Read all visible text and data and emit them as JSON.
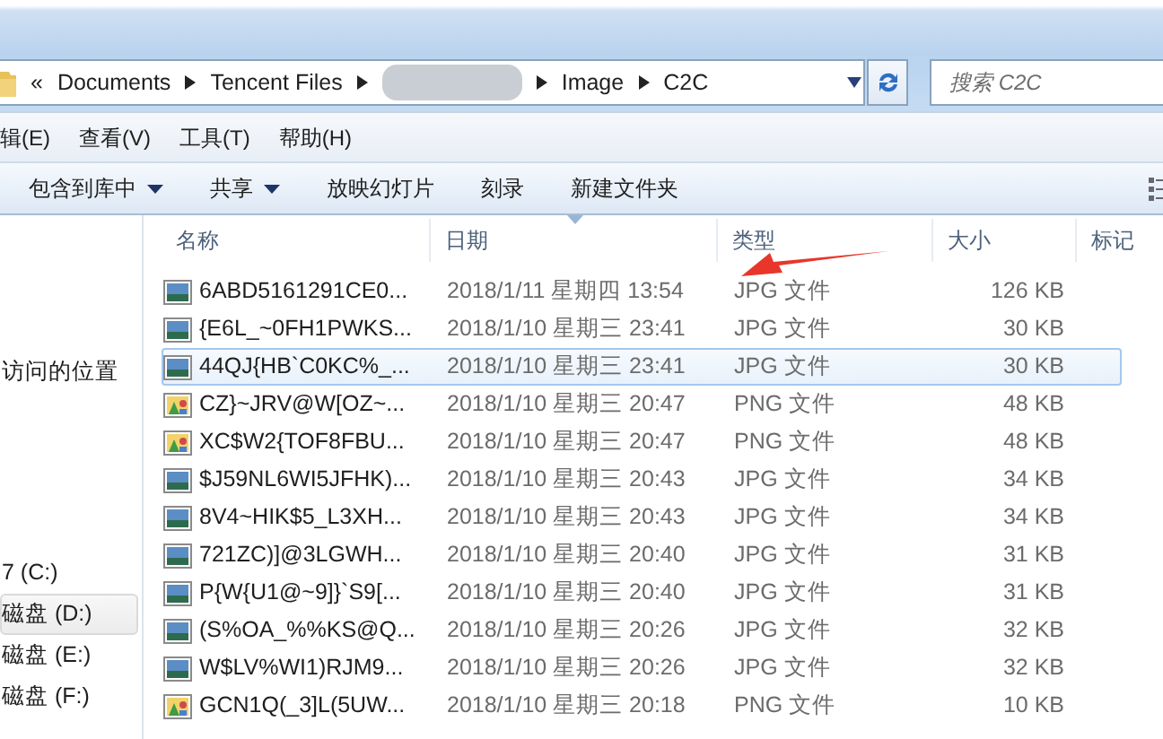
{
  "address_bar": {
    "overflow": "«",
    "crumbs": [
      {
        "kind": "text",
        "label": "Documents"
      },
      {
        "kind": "text",
        "label": "Tencent Files"
      },
      {
        "kind": "redacted"
      },
      {
        "kind": "text",
        "label": "Image"
      },
      {
        "kind": "text",
        "label": "C2C"
      }
    ]
  },
  "search": {
    "placeholder": "搜索 C2C"
  },
  "menu": [
    "辑(E)",
    "查看(V)",
    "工具(T)",
    "帮助(H)"
  ],
  "toolbar": [
    {
      "label": "包含到库中",
      "dropdown": true
    },
    {
      "label": "共享",
      "dropdown": true
    },
    {
      "label": "放映幻灯片",
      "dropdown": false
    },
    {
      "label": "刻录",
      "dropdown": false
    },
    {
      "label": "新建文件夹",
      "dropdown": false
    }
  ],
  "sidebar": [
    {
      "kind": "gap"
    },
    {
      "kind": "item",
      "label": "访问的位置",
      "selected": false
    },
    {
      "kind": "gap"
    },
    {
      "kind": "item",
      "label": "7 (C:)",
      "selected": false
    },
    {
      "kind": "item",
      "label": "磁盘 (D:)",
      "selected": true
    },
    {
      "kind": "item",
      "label": "磁盘 (E:)",
      "selected": false
    },
    {
      "kind": "item",
      "label": "磁盘 (F:)",
      "selected": false
    }
  ],
  "columns": [
    {
      "label": "名称",
      "sorted": false
    },
    {
      "label": "日期",
      "sorted": true
    },
    {
      "label": "类型",
      "sorted": false
    },
    {
      "label": "大小",
      "sorted": false
    },
    {
      "label": "标记",
      "sorted": false
    }
  ],
  "files": [
    {
      "kind": "jpg",
      "name": "6ABD5161291CE0...",
      "date": "2018/1/11 星期四 13:54",
      "type": "JPG 文件",
      "size": "126 KB",
      "selected": false
    },
    {
      "kind": "jpg",
      "name": "{E6L_~0FH1PWKS...",
      "date": "2018/1/10 星期三 23:41",
      "type": "JPG 文件",
      "size": "30 KB",
      "selected": false
    },
    {
      "kind": "jpg",
      "name": "44QJ{HB`C0KC%_...",
      "date": "2018/1/10 星期三 23:41",
      "type": "JPG 文件",
      "size": "30 KB",
      "selected": true
    },
    {
      "kind": "png",
      "name": "CZ}~JRV@W[OZ~...",
      "date": "2018/1/10 星期三 20:47",
      "type": "PNG 文件",
      "size": "48 KB",
      "selected": false
    },
    {
      "kind": "png",
      "name": "XC$W2{TOF8FBU...",
      "date": "2018/1/10 星期三 20:47",
      "type": "PNG 文件",
      "size": "48 KB",
      "selected": false
    },
    {
      "kind": "jpg",
      "name": "$J59NL6WI5JFHK)...",
      "date": "2018/1/10 星期三 20:43",
      "type": "JPG 文件",
      "size": "34 KB",
      "selected": false
    },
    {
      "kind": "jpg",
      "name": "8V4~HIK$5_L3XH...",
      "date": "2018/1/10 星期三 20:43",
      "type": "JPG 文件",
      "size": "34 KB",
      "selected": false
    },
    {
      "kind": "jpg",
      "name": "721ZC)]@3LGWH...",
      "date": "2018/1/10 星期三 20:40",
      "type": "JPG 文件",
      "size": "31 KB",
      "selected": false
    },
    {
      "kind": "jpg",
      "name": "P{W{U1@~9]}`S9[...",
      "date": "2018/1/10 星期三 20:40",
      "type": "JPG 文件",
      "size": "31 KB",
      "selected": false
    },
    {
      "kind": "jpg",
      "name": "(S%OA_%%KS@Q...",
      "date": "2018/1/10 星期三 20:26",
      "type": "JPG 文件",
      "size": "32 KB",
      "selected": false
    },
    {
      "kind": "jpg",
      "name": "W$LV%WI1)RJM9...",
      "date": "2018/1/10 星期三 20:26",
      "type": "JPG 文件",
      "size": "32 KB",
      "selected": false
    },
    {
      "kind": "png",
      "name": "GCN1Q(_3]L(5UW...",
      "date": "2018/1/10 星期三 20:18",
      "type": "PNG 文件",
      "size": "10 KB",
      "selected": false
    }
  ],
  "annotation": {
    "kind": "arrow"
  }
}
